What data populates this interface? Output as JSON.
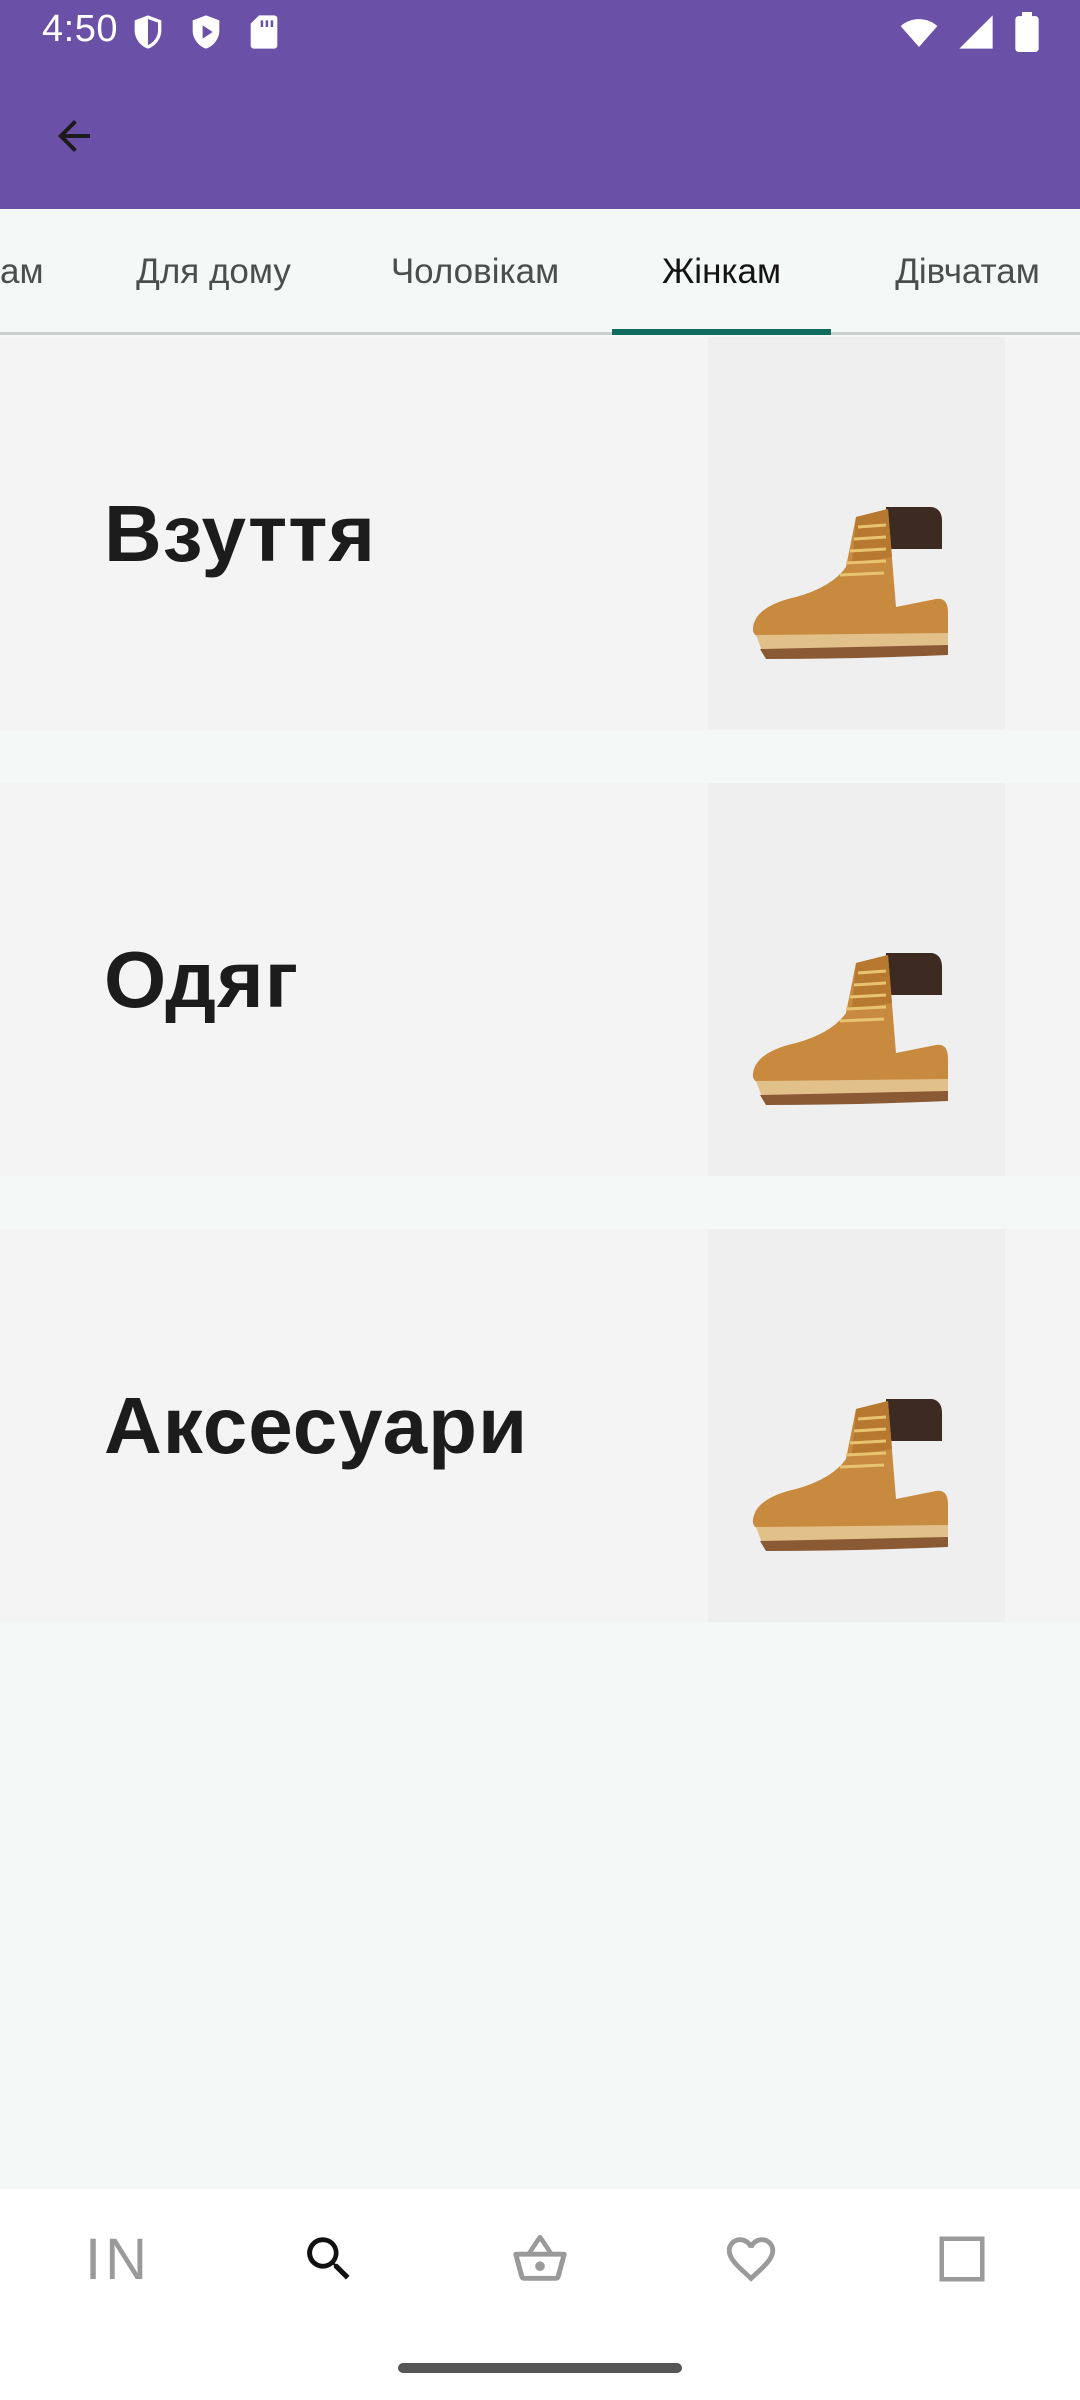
{
  "status_bar": {
    "time": "4:50",
    "left_icons": [
      "shield-icon",
      "play-shield-icon",
      "sd-card-icon"
    ],
    "right_icons": [
      "wifi-icon",
      "signal-icon",
      "battery-icon"
    ]
  },
  "app_bar": {
    "color": "#6a50a7",
    "back_icon": "arrow-left-icon"
  },
  "tabs": {
    "items": [
      {
        "label": "ам"
      },
      {
        "label": "Для дому"
      },
      {
        "label": "Чоловікам"
      },
      {
        "label": "Жінкам",
        "active": true
      },
      {
        "label": "Дівчатам"
      }
    ],
    "indicator_color": "#0e6b5e"
  },
  "categories": [
    {
      "label": "Взуття",
      "image": "boot-image"
    },
    {
      "label": "Одяг",
      "image": "boot-image"
    },
    {
      "label": "Аксесуари",
      "image": "boot-image"
    }
  ],
  "bottom_nav": {
    "items": [
      {
        "name": "logo",
        "label": "IN"
      },
      {
        "name": "search",
        "icon": "search-icon",
        "active": true
      },
      {
        "name": "cart",
        "icon": "basket-icon"
      },
      {
        "name": "favorites",
        "icon": "heart-icon"
      },
      {
        "name": "profile",
        "icon": "square-icon"
      }
    ]
  }
}
